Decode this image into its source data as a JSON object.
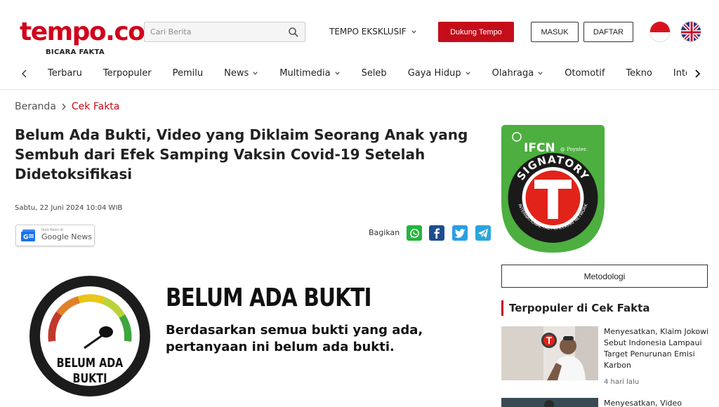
{
  "header": {
    "logo": "tempo.co",
    "tagline": "BICARA FAKTA",
    "search_placeholder": "Cari Berita",
    "eksklusif_label": "TEMPO EKSKLUSIF",
    "dukung_label": "Dukung Tempo",
    "masuk_label": "MASUK",
    "daftar_label": "DAFTAR"
  },
  "nav": {
    "items": [
      {
        "label": "Terbaru",
        "dropdown": false
      },
      {
        "label": "Terpopuler",
        "dropdown": false
      },
      {
        "label": "Pemilu",
        "dropdown": false
      },
      {
        "label": "News",
        "dropdown": true
      },
      {
        "label": "Multimedia",
        "dropdown": true
      },
      {
        "label": "Seleb",
        "dropdown": false
      },
      {
        "label": "Gaya Hidup",
        "dropdown": true
      },
      {
        "label": "Olahraga",
        "dropdown": true
      },
      {
        "label": "Otomotif",
        "dropdown": false
      },
      {
        "label": "Tekno",
        "dropdown": false
      },
      {
        "label": "Interaktif",
        "dropdown": false
      }
    ]
  },
  "breadcrumb": {
    "home": "Beranda",
    "current": "Cek Fakta"
  },
  "article": {
    "title": "Belum Ada Bukti, Video yang Diklaim Seorang Anak yang Sembuh dari Efek Samping Vaksin Covid-19 Setelah Didetoksifikasi",
    "date": "Sabtu, 22 Juni 2024 10:04 WIB",
    "gnews_small": "Ikuti Kami di",
    "gnews_label": "Google News",
    "share_label": "Bagikan"
  },
  "banner": {
    "gauge_label_1": "BELUM ADA",
    "gauge_label_2": "BUKTI",
    "title": "BELUM ADA BUKTI",
    "sub_line1": "Berdasarkan semua bukti yang ada,",
    "sub_line2": "pertanyaan ini belum ada bukti."
  },
  "sidebar": {
    "ifcn_title": "IFCN",
    "ifcn_poynter": "@ Poynter.",
    "ifcn_signatory": "SIGNATORY",
    "ifcn_network": "INTERNATIONAL FACT-CHECKING NETWORK",
    "metodologi_label": "Metodologi",
    "popular_heading": "Terpopuler di Cek Fakta",
    "popular": [
      {
        "title": "Menyesatkan, Klaim Jokowi Sebut Indonesia Lampaui Target Penurunan Emisi Karbon",
        "time": "4 hari lalu"
      },
      {
        "title": "Menyesatkan, Video",
        "time": ""
      }
    ]
  },
  "colors": {
    "brand_red": "#c50d1a",
    "ifcn_green": "#4caf3f"
  }
}
